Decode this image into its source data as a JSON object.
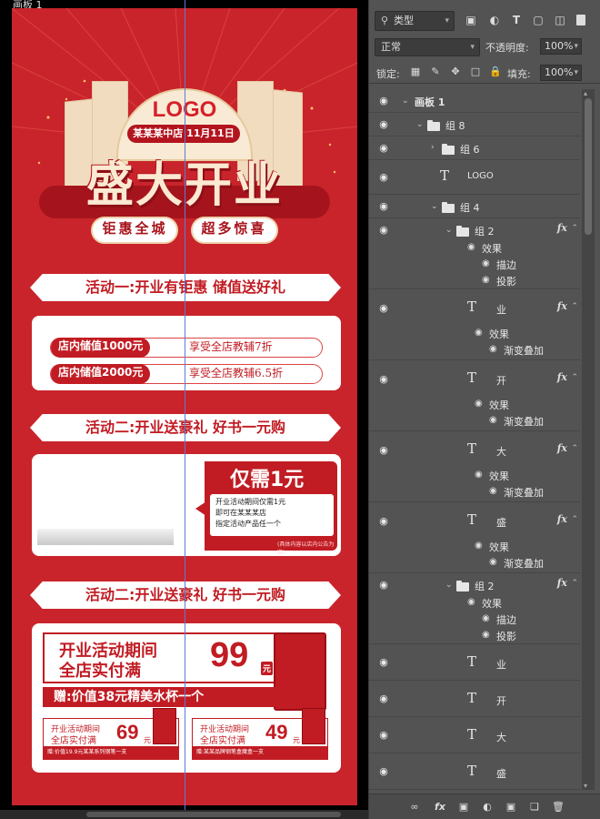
{
  "canvas": {
    "artboard_label": "画板 1",
    "poster": {
      "logo": "LOGO",
      "store_badge": "某某某中店 11月11日",
      "headline": "盛大开业",
      "tags": [
        "钜惠全城",
        "超多惊喜"
      ],
      "section1_title": "活动一:开业有钜惠  储值送好礼",
      "activity1_rows": [
        {
          "pill": "店内储值1000元",
          "text": "享受全店教辅7折"
        },
        {
          "pill": "店内储值2000元",
          "text": "享受全店教辅6.5折"
        }
      ],
      "section2_title": "活动二:开业送豪礼  好书一元购",
      "activity2": {
        "price": "仅需1元",
        "lines": [
          "开业活动期间仅需1元",
          "即可在某某某店",
          "指定活动产品任一个"
        ],
        "note": "(具体内容以店内公告为准)"
      },
      "section3_title": "活动二:开业送豪礼  好书一元购",
      "activity3": {
        "line1": "开业活动期间",
        "line2": "全店实付满",
        "price": "99",
        "unit": "元",
        "gift": "赠:价值38元精美水杯一个",
        "mini": [
          {
            "l1": "开业活动期间",
            "l2": "全店实付满",
            "price": "69",
            "unit": "元",
            "foot": "赠:价值19.9元某某系列钢笔一支"
          },
          {
            "l1": "开业活动期间",
            "l2": "全店实付满",
            "price": "49",
            "unit": "元",
            "foot": "赠:某某品牌钢笔盒魔盒一支"
          }
        ]
      }
    }
  },
  "panel": {
    "filter": {
      "icon": "search-icon",
      "label": "类型"
    },
    "blend_mode": "正常",
    "opacity_label": "不透明度:",
    "opacity_value": "100%",
    "lock_label": "锁定:",
    "fill_label": "填充:",
    "fill_value": "100%",
    "layers": [
      {
        "type": "artboard",
        "name": "画板 1"
      },
      {
        "type": "group",
        "name": "组 8",
        "open": true
      },
      {
        "type": "group",
        "name": "组 6",
        "open": false
      },
      {
        "type": "text",
        "name": "LOGO"
      },
      {
        "type": "group",
        "name": "组 4",
        "open": true
      },
      {
        "type": "group",
        "name": "组 2",
        "open": true,
        "fx": true,
        "effects_label": "效果",
        "effects": [
          "描边",
          "投影"
        ]
      },
      {
        "type": "text",
        "name": "业",
        "fx": true,
        "effects_label": "效果",
        "effects": [
          "渐变叠加"
        ]
      },
      {
        "type": "text",
        "name": "开",
        "fx": true,
        "effects_label": "效果",
        "effects": [
          "渐变叠加"
        ]
      },
      {
        "type": "text",
        "name": "大",
        "fx": true,
        "effects_label": "效果",
        "effects": [
          "渐变叠加"
        ]
      },
      {
        "type": "text",
        "name": "盛",
        "fx": true,
        "effects_label": "效果",
        "effects": [
          "渐变叠加"
        ]
      },
      {
        "type": "group",
        "name": "组 2",
        "open": true,
        "fx": true,
        "effects_label": "效果",
        "effects": [
          "描边",
          "投影"
        ]
      },
      {
        "type": "text",
        "name": "业"
      },
      {
        "type": "text",
        "name": "开"
      },
      {
        "type": "text",
        "name": "大"
      },
      {
        "type": "text",
        "name": "盛"
      }
    ],
    "accent": "#c9242b"
  }
}
